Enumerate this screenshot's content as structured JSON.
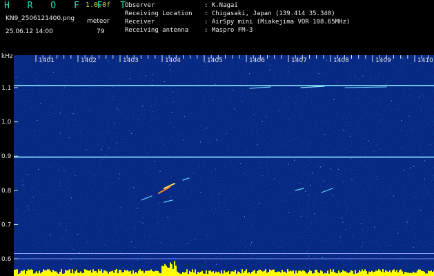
{
  "header": {
    "app_title": "H R O F F T",
    "version": "1.0.0f",
    "filename": "KN9_2506121400.png",
    "meteor_label": "meteor",
    "datetime": "25.06.12 14:00",
    "meteor_count": "79",
    "fields": [
      {
        "label": "Observer",
        "value": ": K.Nagai"
      },
      {
        "label": "Receiving Location",
        "value": ": Chigasaki, Japan (139.414 35.340)"
      },
      {
        "label": "Receiver",
        "value": ": AirSpy mini (Miakejima VOR 108.65MHz)"
      },
      {
        "label": "Receiving antenna",
        "value": ": Maspro FM-3"
      }
    ]
  },
  "spectrogram": {
    "y_unit": "kHz",
    "y_ticks": [
      "1.1",
      "1.0",
      "0.9",
      "0.8",
      "0.7",
      "0.6"
    ],
    "x_ticks": [
      "1401",
      "1402",
      "1403",
      "1404",
      "1405",
      "1406",
      "1407",
      "1408",
      "1409",
      "1410"
    ],
    "carrier_lines_khz": [
      1.106,
      0.897,
      0.615
    ],
    "colors": {
      "background": "#000000",
      "noise_base": "#0a1d7a",
      "carrier": "#8ae8ff",
      "meteor": "#ffe44a",
      "tick_label": "#e6e6e6",
      "bottom_bar": "#ffff00"
    }
  }
}
